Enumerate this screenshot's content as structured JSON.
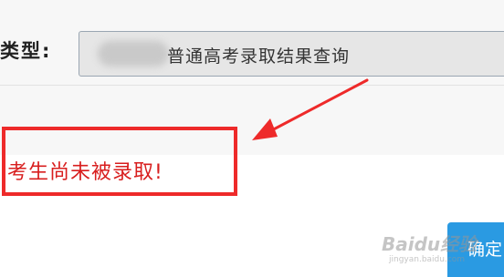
{
  "form": {
    "type_label": "类型:",
    "query_type_value": "普通高考录取结果查询"
  },
  "result": {
    "message": "考生尚未被录取!"
  },
  "actions": {
    "confirm_label": "确定"
  },
  "watermark": {
    "brand": "Baidu经验",
    "url": "jingyan.baidu.com"
  },
  "colors": {
    "annotation_red": "#ee2a2a",
    "result_text": "#d81e1e",
    "button_blue": "#2a9ae2"
  }
}
